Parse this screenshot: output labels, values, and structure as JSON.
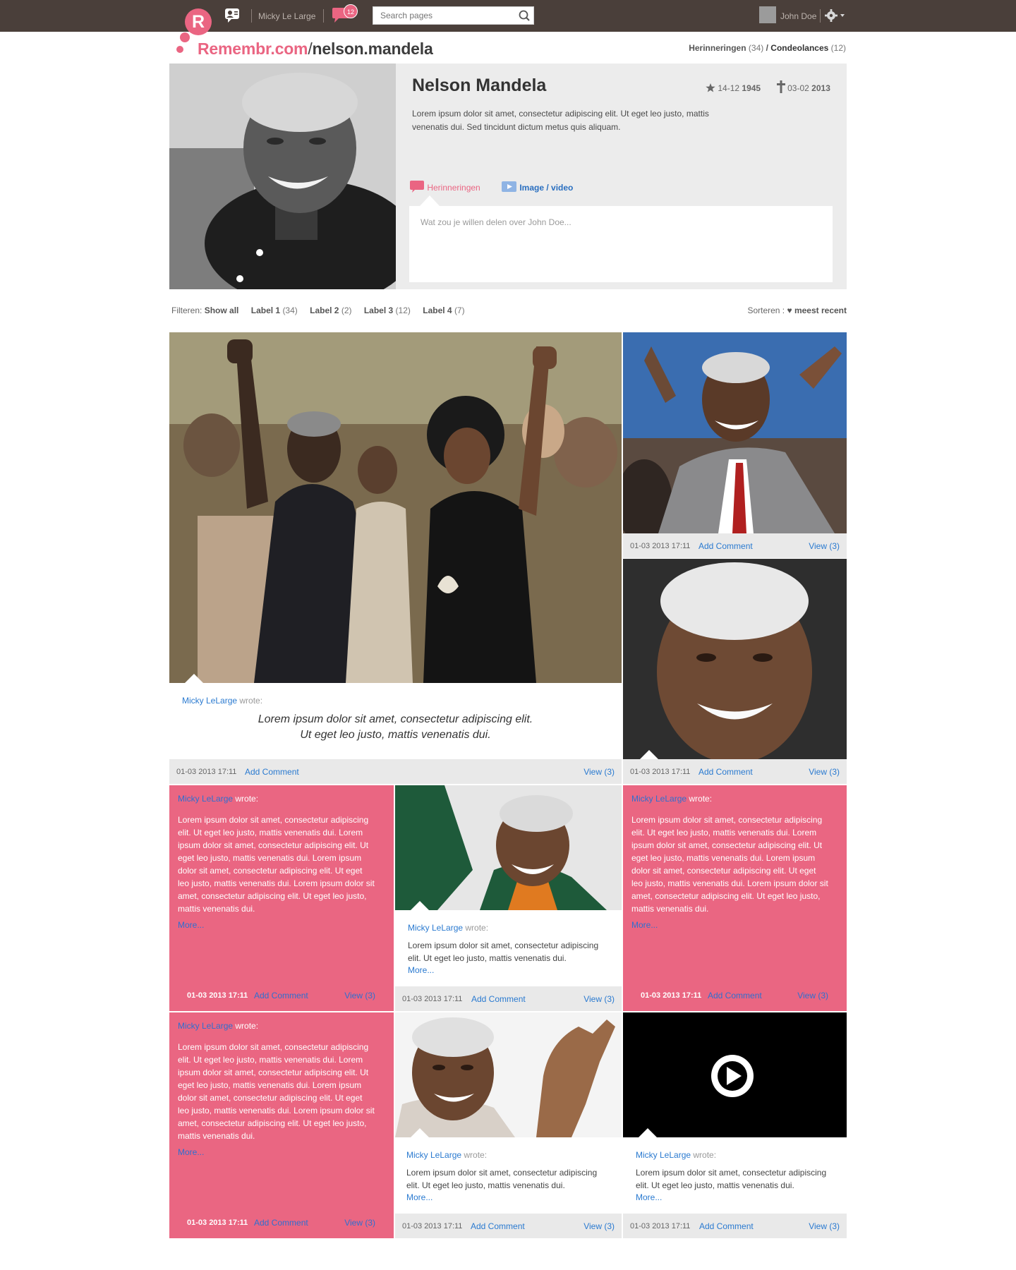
{
  "topbar": {
    "logo_letter": "R",
    "username": "Micky Le Large",
    "notification_count": "12",
    "search_placeholder": "Search pages",
    "account_name": "John Doe"
  },
  "brand": {
    "site": "Remembr.com",
    "slash": "/",
    "page": "nelson.mandela"
  },
  "topnav": {
    "memories_label": "Herinneringen",
    "memories_count": "(34)",
    "separator": "/",
    "condolences_label": "Condeolances",
    "condolences_count": "(12)"
  },
  "profile": {
    "name": "Nelson Mandela",
    "born_day": "14-12",
    "born_year": "1945",
    "died_day": "03-02",
    "died_year": "2013",
    "bio": "Lorem ipsum dolor sit amet, consectetur adipiscing elit. Ut eget leo justo, mattis venenatis dui. Sed tincidunt dictum metus quis aliquam.",
    "tab_memories": "Herinneringen",
    "tab_media": "Image / video",
    "composer_placeholder": "Wat zou je willen delen over John Doe..."
  },
  "filter": {
    "label": "Filteren:",
    "show_all": "Show all",
    "labels": [
      {
        "name": "Label 1",
        "count": "(34)"
      },
      {
        "name": "Label 2",
        "count": "(2)"
      },
      {
        "name": "Label 3",
        "count": "(12)"
      },
      {
        "name": "Label 4",
        "count": "(7)"
      }
    ],
    "sort_label": "Sorteren :",
    "sort_value": "meest recent"
  },
  "post": {
    "author": "Micky LeLarge",
    "wrote": "wrote:",
    "timestamp": "01-03 2013 17:11",
    "add_comment": "Add Comment",
    "view": "View (3)",
    "more": "More...",
    "quote_line1": "Lorem ipsum dolor sit amet, consectetur adipiscing elit.",
    "quote_line2": "Ut eget leo justo, mattis venenatis dui.",
    "short_text": "Lorem ipsum dolor sit amet, consectetur adipiscing elit. Ut eget leo justo, mattis venenatis dui.",
    "long_text": "Lorem ipsum dolor sit amet, consectetur adipiscing elit. Ut eget leo justo, mattis venenatis dui.  Lorem ipsum dolor sit amet, consectetur adipiscing elit. Ut eget leo justo, mattis venenatis dui. Lorem ipsum dolor sit amet, consectetur adipiscing elit. Ut eget leo justo, mattis venenatis dui. Lorem ipsum dolor sit amet, consectetur adipiscing elit. Ut eget leo justo, mattis venenatis dui."
  },
  "colors": {
    "brand_pink": "#ea6582",
    "topbar_brown": "#4a3f3a",
    "link_blue": "#2a7ad0"
  }
}
